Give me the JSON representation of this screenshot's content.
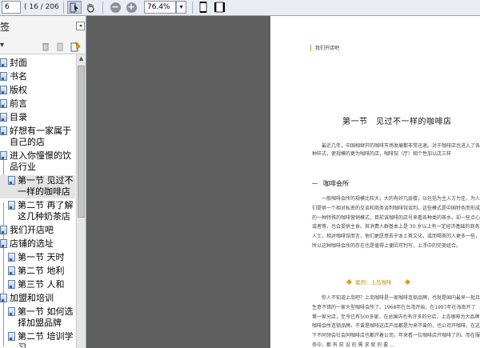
{
  "toolbar": {
    "page_number": "6",
    "page_count": "( 16 / 206 )",
    "zoom": "76.4%",
    "icons": [
      "select-tool-icon",
      "hand-tool-icon",
      "zoom-out-icon",
      "zoom-in-icon",
      "zoom-dropdown-icon",
      "fit-page-icon",
      "fit-width-icon"
    ]
  },
  "panel": {
    "title": "签",
    "close_glyph": "◂",
    "options_glyph": "▾"
  },
  "bookmarks": [
    {
      "label": "封面",
      "level": 0
    },
    {
      "label": "书名",
      "level": 0
    },
    {
      "label": "版权",
      "level": 0
    },
    {
      "label": "前言",
      "level": 0
    },
    {
      "label": "目录",
      "level": 0
    },
    {
      "label": "好想有一家属于自己的店",
      "level": 0
    },
    {
      "label": "进入你憧憬的饮品行业",
      "level": 0
    },
    {
      "label": "第一节 见过不一样的咖啡店",
      "level": 1,
      "selected": true
    },
    {
      "label": "第二节 再了解这几种奶茶店",
      "level": 1
    },
    {
      "label": "我们开店吧",
      "level": 0
    },
    {
      "label": "店铺的选址",
      "level": 0
    },
    {
      "label": "第一节 天时",
      "level": 1
    },
    {
      "label": "第二节 地利",
      "level": 1
    },
    {
      "label": "第三节 人和",
      "level": 1
    },
    {
      "label": "加盟和培训",
      "level": 0
    },
    {
      "label": "第一节 如何选择加盟品牌",
      "level": 1
    },
    {
      "label": "第二节 培训学习",
      "level": 1
    }
  ],
  "document": {
    "running_header": "我们开店吧",
    "section_title": "第一节　见过不一样的咖啡店",
    "intro": "最近几年，中国相继开的咖啡市场发展都非常迅速。对于咖啡店也进入了各种样式，使规模的更为咖啡的店，咖啡馆（厅）相个性加以店三样",
    "subheading_marker": "一",
    "subheading": "咖啡会所",
    "body_1": "一般咖啡会所的规模比较大，大的有好几层楼，以包括为主入方为佳，为人们提供一个相对私密的交谈和商务谈判咖啡馆谈判。这些模式是中国特色而形成的一种特殊的咖啡营销模式，目前该咖啡的店号来看各种类的茶水，却一些点心或者等，也会提供主食。其消费人群基本上是 30 岁以上有一定经济基础的商务人士，相对咖啡馆而言，他们更愿意去于本土茶文化，或而喝茶的人更多一些，所以这种咖啡会所的存在也是值得上便因可判写，上浮中的完美组合。",
    "case_label": "案例：上岛咖啡",
    "body_2": "你人不知道上岛吧？上岛咖啡是一家咖啡连锁品牌，也就是国内最早一批且生意不错的一家大型咖啡会所了。1968年在台湾开始，在1997年在海南开了第一家分店，至今已有500多家，在总国内也有许多的分店，上岛咖啡为大品牌咖啡会所连锁品牌。不曾是咖啡这店产品都是为来不曾的，也公司开咖啡。在这下不同领会社会同咖啡店也都开着公司，年来看一位咖啡店开咖啡了的。而在服务中，都 有 前 设 的 需 求 就 的 要 ..."
  }
}
